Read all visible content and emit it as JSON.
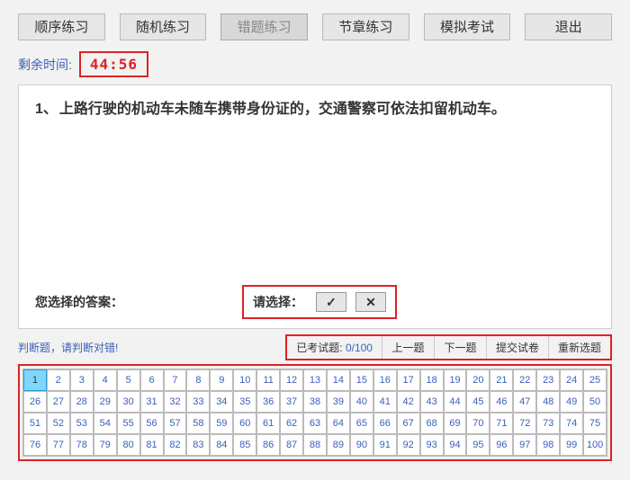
{
  "tabs": {
    "sequence": "顺序练习",
    "random": "随机练习",
    "wrong": "错题练习",
    "chapter": "节章练习",
    "mock": "模拟考试",
    "exit": "退出"
  },
  "timer": {
    "label": "剩余时间:",
    "value": "44:56"
  },
  "question": {
    "number": "1、",
    "text": "上路行驶的机动车未随车携带身份证的，交通警察可依法扣留机动车。"
  },
  "answer": {
    "your_answer_label": "您选择的答案：",
    "choose_label": "请选择：",
    "true_symbol": "✓",
    "false_symbol": "✕"
  },
  "hint": "判断题，请判断对错!",
  "midbar": {
    "done_label": "已考试题:",
    "done_count": "0/100",
    "prev": "上一题",
    "next": "下一题",
    "submit": "提交试卷",
    "reset": "重新选题"
  },
  "grid": {
    "total": 100,
    "current": 1
  }
}
